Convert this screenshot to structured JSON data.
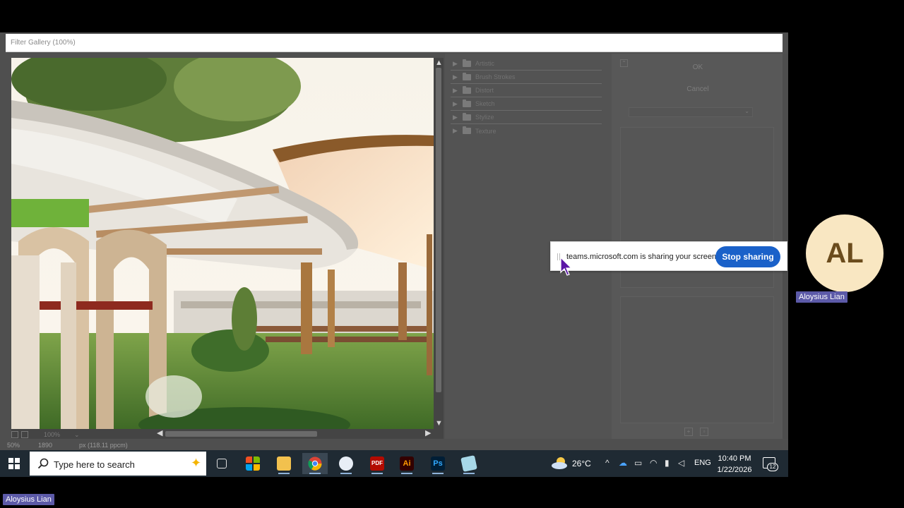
{
  "filter_gallery": {
    "title": "Filter Gallery (100%)",
    "zoom": "100%",
    "categories": [
      "Artistic",
      "Brush Strokes",
      "Distort",
      "Sketch",
      "Stylize",
      "Texture"
    ],
    "ok_label": "OK",
    "cancel_label": "Cancel"
  },
  "status_row": {
    "zoom_level": "50%",
    "width_text": "1890",
    "resolution_text": "px (118.11 ppcm)"
  },
  "share_banner": {
    "message": "teams.microsoft.com is sharing your screen.",
    "stop_label": "Stop sharing"
  },
  "taskbar": {
    "search_placeholder": "Type here to search",
    "apps": [
      "Task View",
      "Microsoft Store",
      "File Explorer",
      "Google Chrome",
      "Paint",
      "Acrobat",
      "Illustrator",
      "Photoshop",
      "Notepad"
    ],
    "photoshop_glyph": "Ps",
    "illustrator_glyph": "Ai",
    "acrobat_glyph": "PDF",
    "weather_temp": "26°C",
    "language": "ENG",
    "time": "10:40 PM",
    "date": "1/22/2026",
    "notification_count": "12"
  },
  "participant": {
    "initials": "AL",
    "name": "Aloysius Lian"
  },
  "local_user": {
    "name": "Aloysius Lian"
  },
  "colors": {
    "stop_sharing_button": "#1a61c9",
    "avatar_bg": "#f9e7c2",
    "name_tag_bg": "#5c5aa8",
    "taskbar_bg": "#1f2a33"
  }
}
